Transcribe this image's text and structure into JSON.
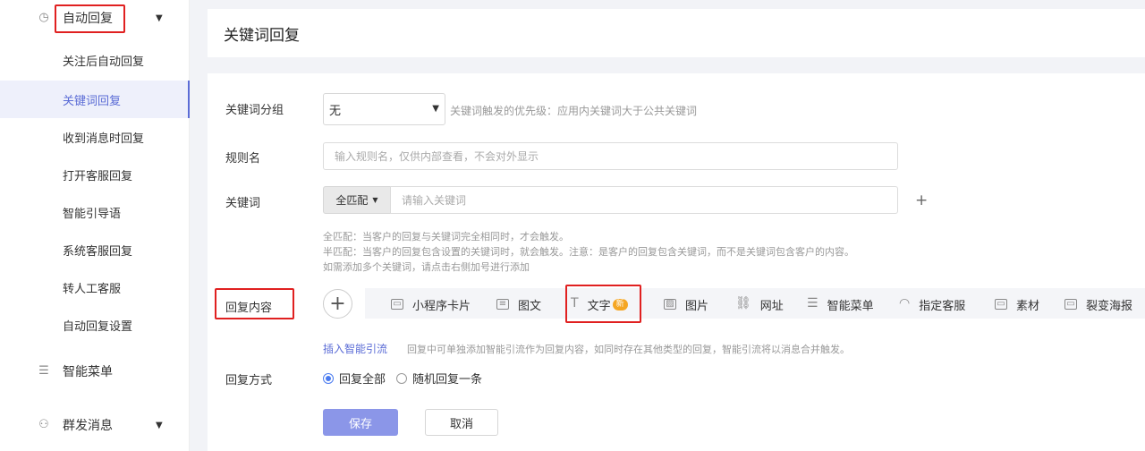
{
  "sidebar": {
    "group_autoreply": "自动回复",
    "items": [
      {
        "label": "关注后自动回复"
      },
      {
        "label": "关键词回复"
      },
      {
        "label": "收到消息时回复"
      },
      {
        "label": "打开客服回复"
      },
      {
        "label": "智能引导语"
      },
      {
        "label": "系统客服回复"
      },
      {
        "label": "转人工客服"
      },
      {
        "label": "自动回复设置"
      }
    ],
    "group_menu": "智能菜单",
    "group_broadcast": "群发消息"
  },
  "header": {
    "title": "关键词回复"
  },
  "form": {
    "group_label": "关键词分组",
    "group_value": "无",
    "group_hint": "关键词触发的优先级：应用内关键词大于公共关键词",
    "rule_label": "规则名",
    "rule_placeholder": "输入规则名，仅供内部查看，不会对外显示",
    "keyword_label": "关键词",
    "match_value": "全匹配",
    "keyword_placeholder": "请输入关键词",
    "keyword_add": "+",
    "note_line1": "全匹配：当客户的回复与关键词完全相同时，才会触发。",
    "note_line2": "半匹配：当客户的回复包含设置的关键词时，就会触发。注意：是客户的回复包含关键词，而不是关键词包含客户的内容。",
    "note_line3": "如需添加多个关键词，请点击右侧加号进行添加",
    "reply_label": "回复内容",
    "tools": [
      {
        "label": "小程序卡片",
        "icon": "miniprogram-icon"
      },
      {
        "label": "图文",
        "icon": "article-icon"
      },
      {
        "label": "文字",
        "icon": "text-icon",
        "badge": "新"
      },
      {
        "label": "图片",
        "icon": "image-icon"
      },
      {
        "label": "网址",
        "icon": "link-icon"
      },
      {
        "label": "智能菜单",
        "icon": "menu-icon"
      },
      {
        "label": "指定客服",
        "icon": "headset-icon"
      },
      {
        "label": "素材",
        "icon": "material-icon"
      },
      {
        "label": "裂变海报",
        "icon": "poster-icon"
      }
    ],
    "insert_link": "插入智能引流",
    "insert_hint": "回复中可单独添加智能引流作为回复内容，如同时存在其他类型的回复，智能引流将以消息合并触发。",
    "mode_label": "回复方式",
    "mode_all": "回复全部",
    "mode_random": "随机回复一条",
    "save": "保存",
    "cancel": "取消"
  },
  "colors": {
    "accent": "#5b6cd6",
    "highlight_box": "#e02020",
    "save_button": "#8b96e8"
  }
}
